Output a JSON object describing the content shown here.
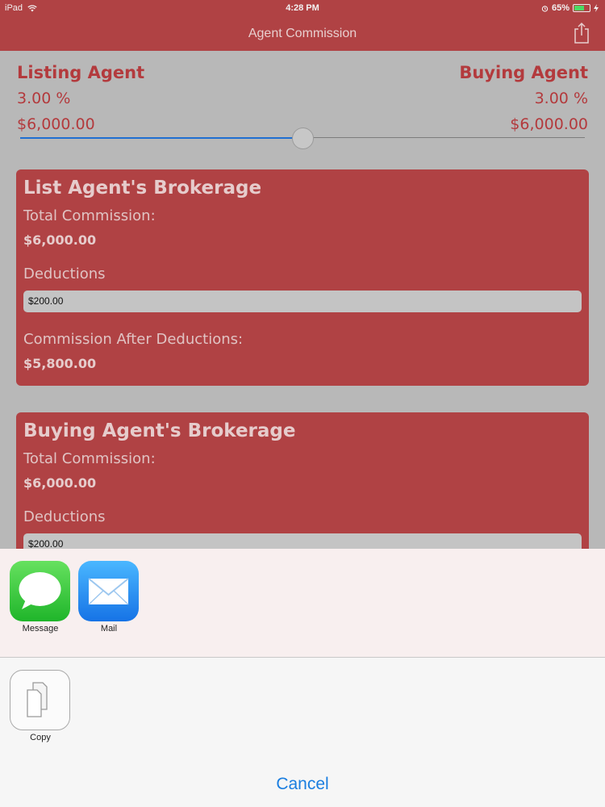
{
  "status_bar": {
    "device": "iPad",
    "time": "4:28 PM",
    "battery": "65%",
    "battery_level": 0.65
  },
  "nav": {
    "title": "Agent Commission",
    "share_icon": "share-icon"
  },
  "listing_agent": {
    "heading": "Listing Agent",
    "percent": "3.00 %",
    "amount": "$6,000.00"
  },
  "buying_agent": {
    "heading": "Buying Agent",
    "percent": "3.00 %",
    "amount": "$6,000.00"
  },
  "split_slider": {
    "value": 0.5
  },
  "list_brokerage": {
    "title": "List Agent's Brokerage",
    "total_label": "Total Commission:",
    "total_value": "$6,000.00",
    "deductions_label": "Deductions",
    "deductions_value": "$200.00",
    "after_label": "Commission After Deductions:",
    "after_value": "$5,800.00"
  },
  "buying_brokerage": {
    "title": "Buying Agent's Brokerage",
    "total_label": "Total Commission:",
    "total_value": "$6,000.00",
    "deductions_label": "Deductions",
    "deductions_value": "$200.00"
  },
  "share_sheet": {
    "apps": [
      {
        "label": "Message",
        "icon": "message-icon"
      },
      {
        "label": "Mail",
        "icon": "mail-icon"
      }
    ],
    "actions": [
      {
        "label": "Copy",
        "icon": "copy-icon"
      }
    ],
    "cancel_label": "Cancel"
  },
  "colors": {
    "brand_red": "#b04244",
    "text_red": "#b33a3d",
    "slider_blue": "#1f6fd1",
    "cancel_blue": "#1a7ee0"
  }
}
